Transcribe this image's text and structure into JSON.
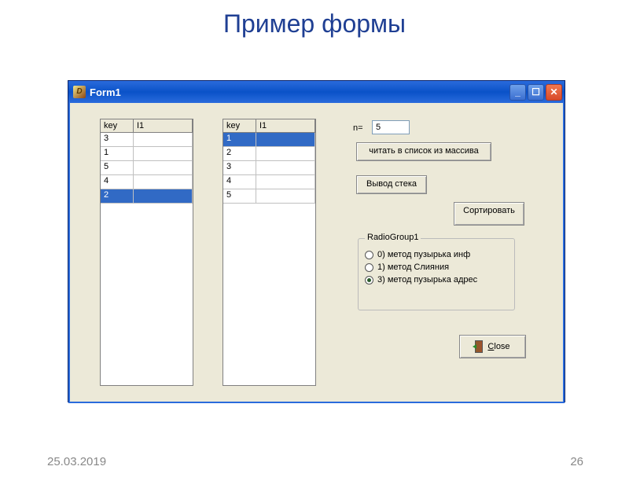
{
  "slide": {
    "title": "Пример формы",
    "date": "25.03.2019",
    "page_number": "26"
  },
  "window": {
    "title": "Form1"
  },
  "grid1": {
    "headers": {
      "key": "key",
      "i1": "I1"
    },
    "rows": [
      "3",
      "1",
      "5",
      "4",
      "2"
    ],
    "selected_index": 4
  },
  "grid2": {
    "headers": {
      "key": "key",
      "i1": "I1"
    },
    "rows": [
      "1",
      "2",
      "3",
      "4",
      "5"
    ],
    "selected_index": 0
  },
  "controls": {
    "n_label": "n=",
    "n_value": "5",
    "btn_read": "читать в список из массива",
    "btn_stack": "Вывод стека",
    "btn_sort": "Сортировать",
    "btn_close": "Close"
  },
  "radiogroup": {
    "caption": "RadioGroup1",
    "items": [
      {
        "label": "0) метод пузырька инф",
        "checked": false
      },
      {
        "label": "1) метод Слияния",
        "checked": false
      },
      {
        "label": "3) метод пузырька адрес",
        "checked": true
      }
    ]
  }
}
